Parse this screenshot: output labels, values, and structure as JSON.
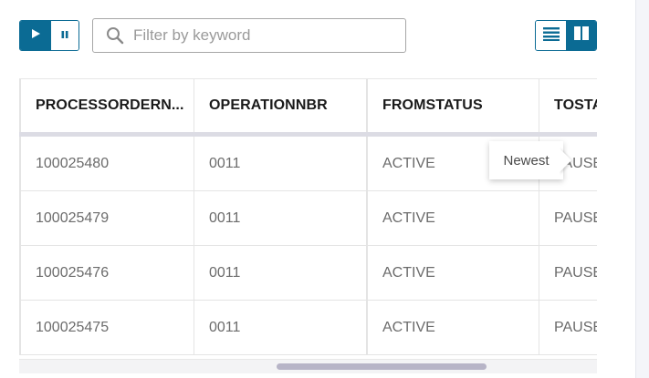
{
  "toolbar": {
    "play_icon": "play-icon",
    "pause_icon": "pause-icon",
    "search": {
      "placeholder": "Filter by keyword",
      "value": "",
      "icon": "search-icon"
    },
    "view_toggle": {
      "list_icon": "list-view-icon",
      "card_icon": "split-view-icon",
      "selected": "card"
    }
  },
  "table": {
    "columns": [
      "PROCESSORDERN...",
      "OPERATIONNBR",
      "FROMSTATUS",
      "TOSTA"
    ],
    "rows": [
      [
        "100025480",
        "0011",
        "ACTIVE",
        "PAUSEI"
      ],
      [
        "100025479",
        "0011",
        "ACTIVE",
        "PAUSEI"
      ],
      [
        "100025476",
        "0011",
        "ACTIVE",
        "PAUSEI"
      ],
      [
        "100025475",
        "0011",
        "ACTIVE",
        "PAUSEI"
      ]
    ]
  },
  "tooltip": {
    "text": "Newest"
  },
  "colors": {
    "accent": "#0b6b94",
    "header_divider": "#dcdce4",
    "scroll_thumb": "#b7b4c7"
  }
}
